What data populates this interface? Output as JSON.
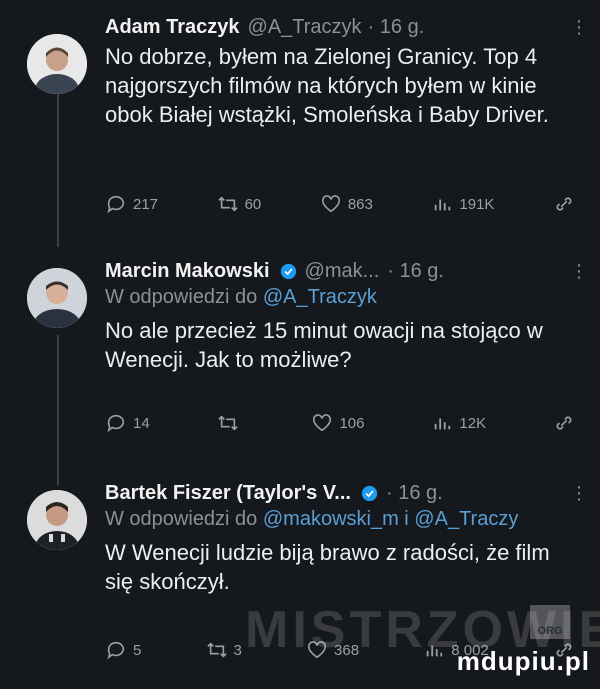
{
  "tweets": [
    {
      "name": "Adam Traczyk",
      "handle": "@A_Traczyk",
      "time": "· 16 g.",
      "verified": false,
      "reply_to_prefix": "",
      "reply_to_mentions": "",
      "text": "No dobrze, byłem na Zielonej Granicy. Top 4 najgorszych filmów na których byłem w kinie obok Białej wstążki, Smoleńska i Baby Driver.",
      "replies": "217",
      "retweets": "60",
      "likes": "863",
      "views": "191K"
    },
    {
      "name": "Marcin Makowski",
      "handle": "@mak...",
      "time": "· 16 g.",
      "verified": true,
      "reply_to_prefix": "W odpowiedzi do",
      "reply_to_mentions": "@A_Traczyk",
      "text": "No ale przecież 15 minut owacji na stojąco w Wenecji. Jak to możliwe?",
      "replies": "14",
      "retweets": "",
      "likes": "106",
      "views": "12K"
    },
    {
      "name": "Bartek Fiszer (Taylor's V...",
      "handle": "",
      "time": "· 16 g.",
      "verified": true,
      "reply_to_prefix": "W odpowiedzi do",
      "reply_to_mentions": "@makowski_m i @A_Traczy",
      "text": "W Wenecji ludzie biją brawo z radości, że film się skończył.",
      "replies": "5",
      "retweets": "3",
      "likes": "368",
      "views": "8 002"
    }
  ],
  "more_label": "⋮",
  "watermark": "MISTRZOWIE",
  "watermark_badge": "ORG",
  "site_logo": "mdupiu.pl",
  "colors": {
    "background": "#15181c",
    "mention": "#5a9fd6",
    "verified": "#1d9bf0"
  }
}
